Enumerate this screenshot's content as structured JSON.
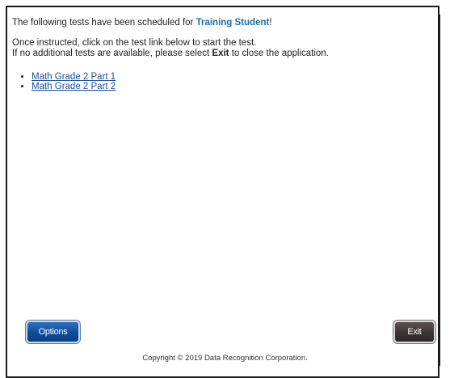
{
  "intro": {
    "prefix": "The following tests have been scheduled for ",
    "student_name": "Training Student",
    "suffix": "!"
  },
  "instructions": {
    "line1": "Once instructed, click on the test link below to start the test.",
    "line2_prefix": "If no additional tests are available, please select ",
    "line2_bold": "Exit",
    "line2_suffix": " to close the application."
  },
  "tests": [
    {
      "label": "Math Grade 2 Part 1"
    },
    {
      "label": "Math Grade 2 Part 2"
    }
  ],
  "buttons": {
    "options_label": "Options",
    "exit_label": "Exit"
  },
  "footer": {
    "copyright": "Copyright © 2019 Data Recognition Corporation."
  }
}
